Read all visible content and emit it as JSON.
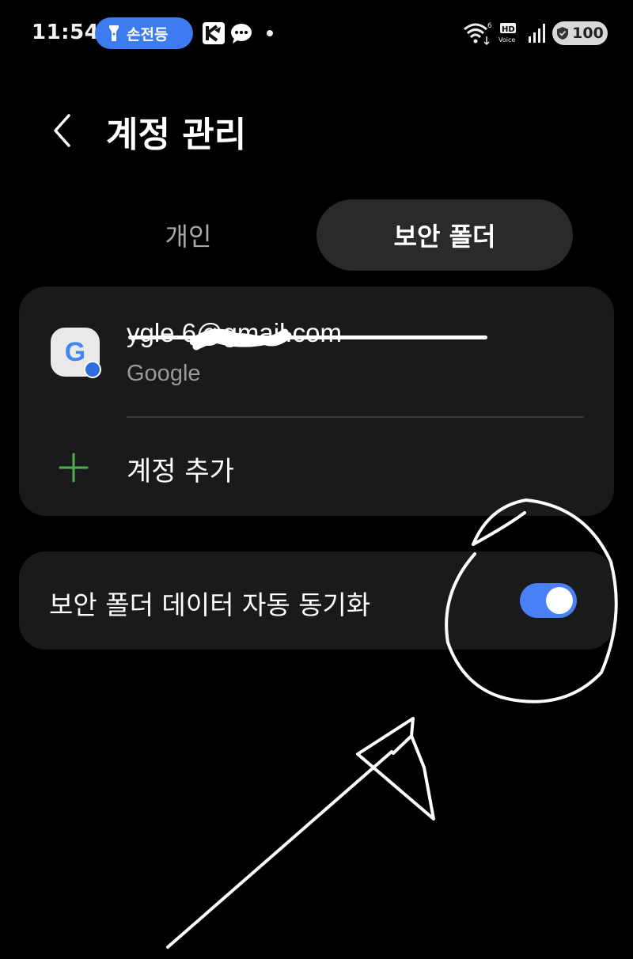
{
  "status_bar": {
    "time": "11:54",
    "flashlight_label": "손전등",
    "battery": "100",
    "hd_label": "HD",
    "voice_label": "Voice",
    "wifi_badge": "6"
  },
  "header": {
    "title": "계정 관리"
  },
  "tabs": [
    {
      "label": "개인",
      "selected": false
    },
    {
      "label": "보안 폴더",
      "selected": true
    }
  ],
  "account": {
    "email": "ygle  6@gmail.com",
    "provider": "Google",
    "icon_letter": "G"
  },
  "add_account": {
    "label": "계정 추가"
  },
  "sync": {
    "label": "보안 폴더 데이터 자동 동기화",
    "enabled": true
  },
  "colors": {
    "accent": "#4a80f5",
    "plus": "#4caf50",
    "card": "#1a1a1c",
    "tab_selected": "#2a2a2c"
  }
}
